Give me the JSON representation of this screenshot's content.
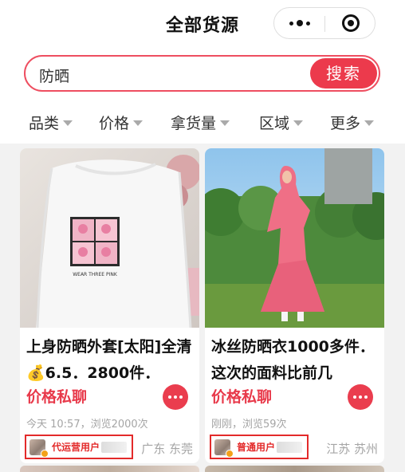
{
  "header": {
    "title": "全部货源"
  },
  "search": {
    "value": "防晒",
    "button_label": "搜索"
  },
  "filters": [
    {
      "label": "品类"
    },
    {
      "label": "价格"
    },
    {
      "label": "拿货量"
    },
    {
      "label": "区域"
    },
    {
      "label": "更多"
    }
  ],
  "products": [
    {
      "description": "上身防晒外套[太阳]全清💰6.5．2800件．",
      "price_label": "价格私聊",
      "time_views": "今天 10:57，浏览2000次",
      "user_type": "代运营用户",
      "location": "广东 东莞",
      "print_text": "WEAR THREE PINK"
    },
    {
      "description": "冰丝防晒衣1000多件．这次的面料比前几",
      "price_label": "价格私聊",
      "time_views": "刚刚，浏览59次",
      "user_type": "普通用户",
      "location": "江苏 苏州"
    }
  ],
  "colors": {
    "accent": "#ec3a4c",
    "highlight_box": "#e32a2a"
  }
}
